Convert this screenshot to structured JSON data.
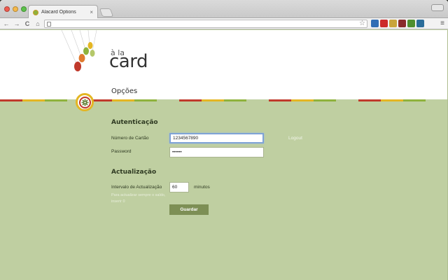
{
  "browser": {
    "tab_title": "Alacard Options",
    "tab_close": "×",
    "nav": {
      "back": "←",
      "forward": "→",
      "reload": "C",
      "home": "⌂"
    },
    "star": "☆",
    "menu": "≡",
    "extensions": [
      {
        "name": "extension-icon-1",
        "color": "#2f6db5"
      },
      {
        "name": "extension-icon-2",
        "color": "#cc2a2a"
      },
      {
        "name": "extension-icon-3",
        "color": "#c9a43a"
      },
      {
        "name": "extension-icon-4",
        "color": "#8a2b2b"
      },
      {
        "name": "extension-icon-5",
        "color": "#4f8f2f"
      },
      {
        "name": "extension-icon-6",
        "color": "#2b6d9a"
      }
    ]
  },
  "logo": {
    "small": "à la",
    "big": "card"
  },
  "page": {
    "title": "Opções"
  },
  "auth": {
    "heading": "Autenticação",
    "card_label": "Número de Cartão",
    "card_value": "1234567890",
    "password_label": "Password",
    "password_value": "••••••",
    "logout": "Logout"
  },
  "update": {
    "heading": "Actualização",
    "interval_label": "Intervalo de Actualização",
    "interval_value": "60",
    "units": "minutos",
    "hint": "Para actualizar sempre o saldo, inserir 0"
  },
  "save_label": "Guardar",
  "colors": {
    "background": "#bfcfa1",
    "button": "#7d8f55",
    "stripe": [
      "#c0392b",
      "#e4b623",
      "#8fb23c",
      "#bfcfa1"
    ]
  }
}
